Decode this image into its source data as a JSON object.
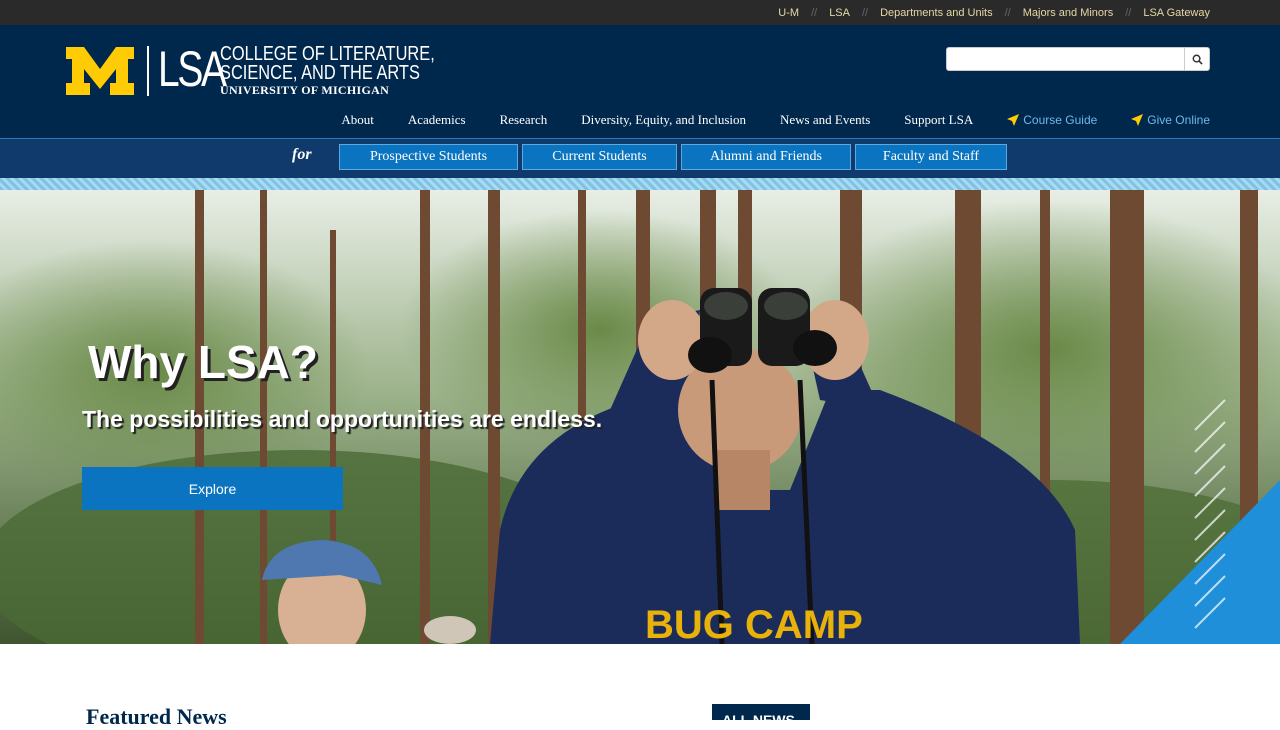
{
  "topbar": {
    "links": [
      "U-M",
      "LSA",
      "Departments and Units",
      "Majors and Minors",
      "LSA Gateway"
    ],
    "separator": "//"
  },
  "header": {
    "logo_m": "M",
    "logo_lsa": "LSA",
    "logo_line1": "COLLEGE OF LITERATURE,",
    "logo_line2": "SCIENCE, AND THE ARTS",
    "logo_line3": "UNIVERSITY OF MICHIGAN",
    "search": {
      "value": "",
      "placeholder": ""
    },
    "nav": [
      "About",
      "Academics",
      "Research",
      "Diversity, Equity, and Inclusion",
      "News and Events",
      "Support LSA"
    ],
    "util_links": [
      "Course Guide",
      "Give Online"
    ]
  },
  "audience": {
    "for_label": "for",
    "buttons": [
      "Prospective Students",
      "Current Students",
      "Alumni and Friends",
      "Faculty and Staff"
    ]
  },
  "hero": {
    "title": "Why LSA?",
    "subtitle": "The possibilities and opportunities are endless.",
    "cta": "Explore",
    "shirt_text": "BUG CAMP"
  },
  "sections": {
    "featured_title": "Featured News",
    "all_news": "ALL NEWS"
  },
  "colors": {
    "maize": "#ffcb05",
    "blue": "#00274c",
    "accent": "#0a74c0"
  }
}
